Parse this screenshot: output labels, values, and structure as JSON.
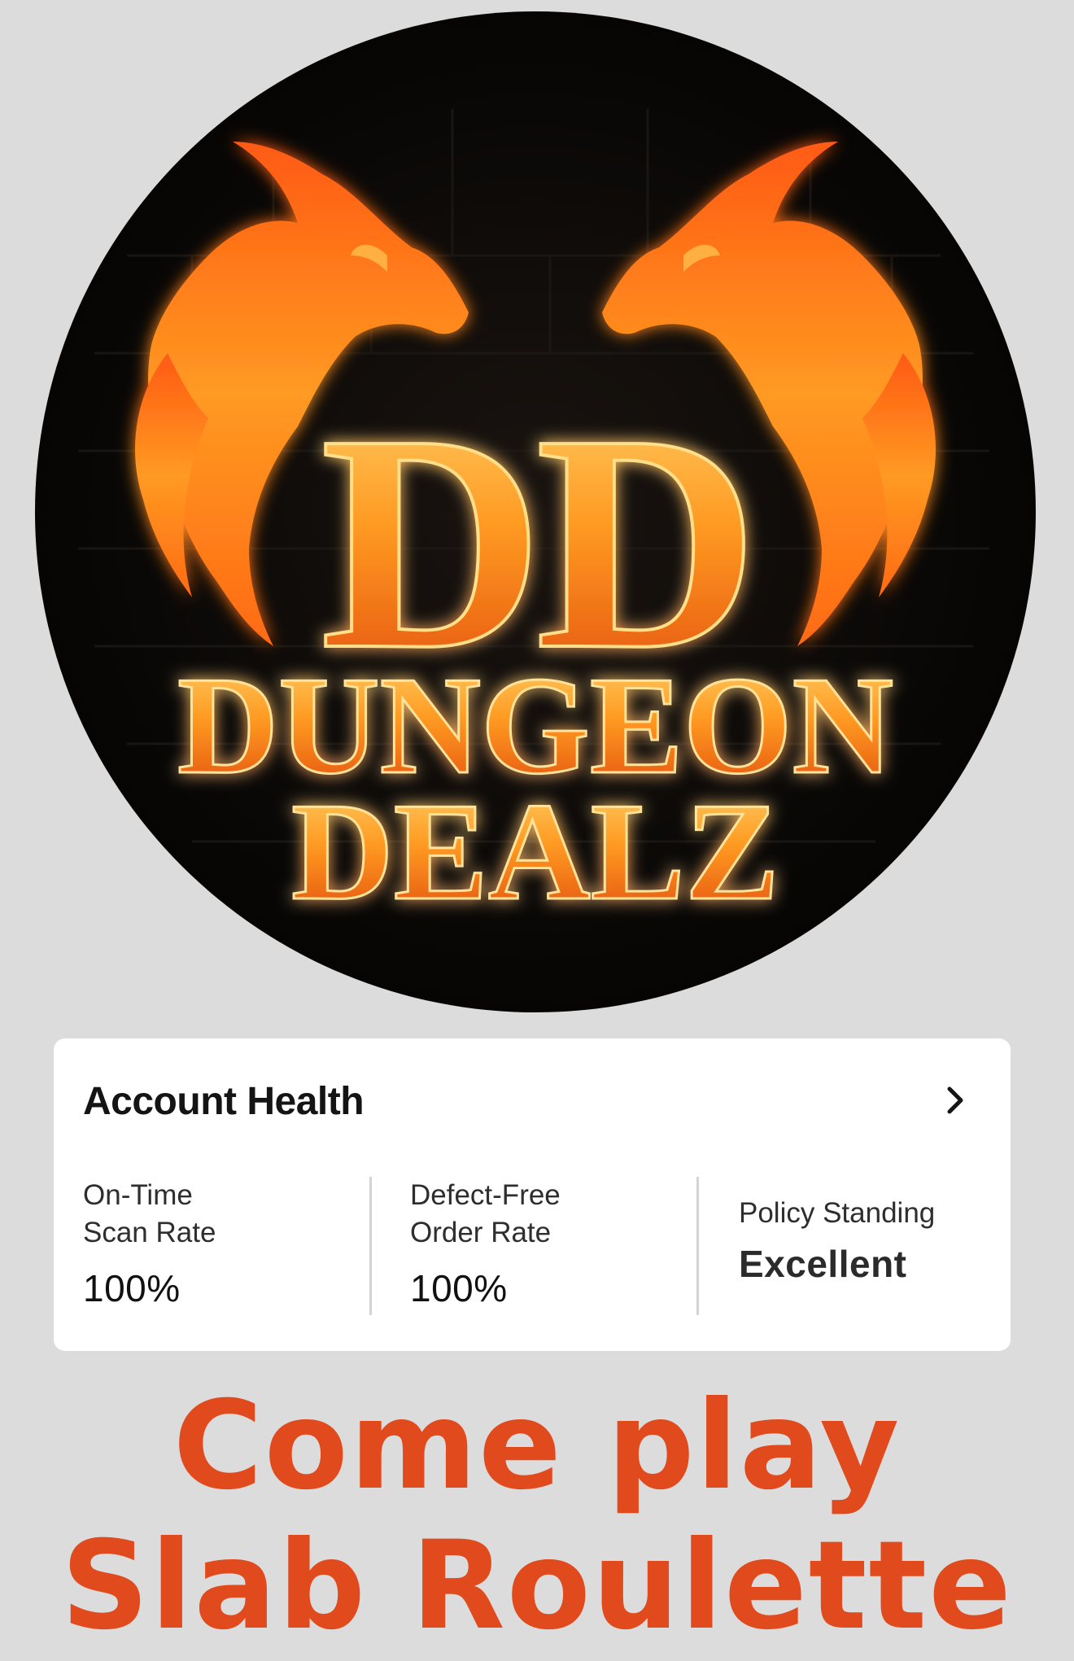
{
  "logo": {
    "monogram": "DD",
    "line1": "DUNGEON",
    "line2": "DEALZ"
  },
  "card": {
    "title": "Account Health",
    "chevron_icon": "chevron-right-icon",
    "metrics": [
      {
        "label": "On-Time\nScan Rate",
        "value": "100%"
      },
      {
        "label": "Defect-Free\nOrder Rate",
        "value": "100%"
      },
      {
        "label": "Policy Standing",
        "value": "Excellent"
      }
    ]
  },
  "slogan": {
    "line1": "Come play",
    "line2": "Slab Roulette"
  },
  "colors": {
    "background": "#dcdcdc",
    "logo_circle": "#0d0b09",
    "fire_orange": "#ff8a1a",
    "fire_red": "#c62a0a",
    "slogan": "#e04a1c"
  }
}
